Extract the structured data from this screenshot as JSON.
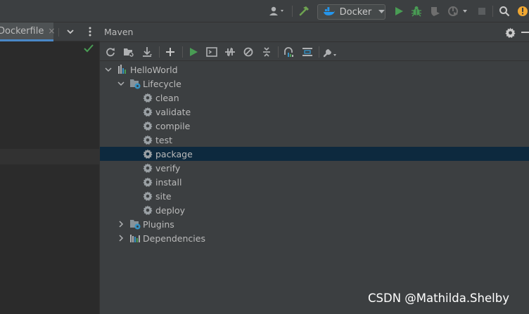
{
  "toolbar": {
    "run_config": "Docker"
  },
  "editor": {
    "tab_label": "Dockerfile",
    "tab_close": "×"
  },
  "maven": {
    "title": "Maven",
    "tree": {
      "project": "HelloWorld",
      "lifecycle": "Lifecycle",
      "goals": [
        "clean",
        "validate",
        "compile",
        "test",
        "package",
        "verify",
        "install",
        "site",
        "deploy"
      ],
      "selected_goal": "package",
      "plugins": "Plugins",
      "dependencies": "Dependencies"
    }
  },
  "watermark": "CSDN @Mathilda.Shelby",
  "colors": {
    "selection": "#0d293e",
    "run_green": "#499c54",
    "accent_blue": "#4a88c7"
  }
}
